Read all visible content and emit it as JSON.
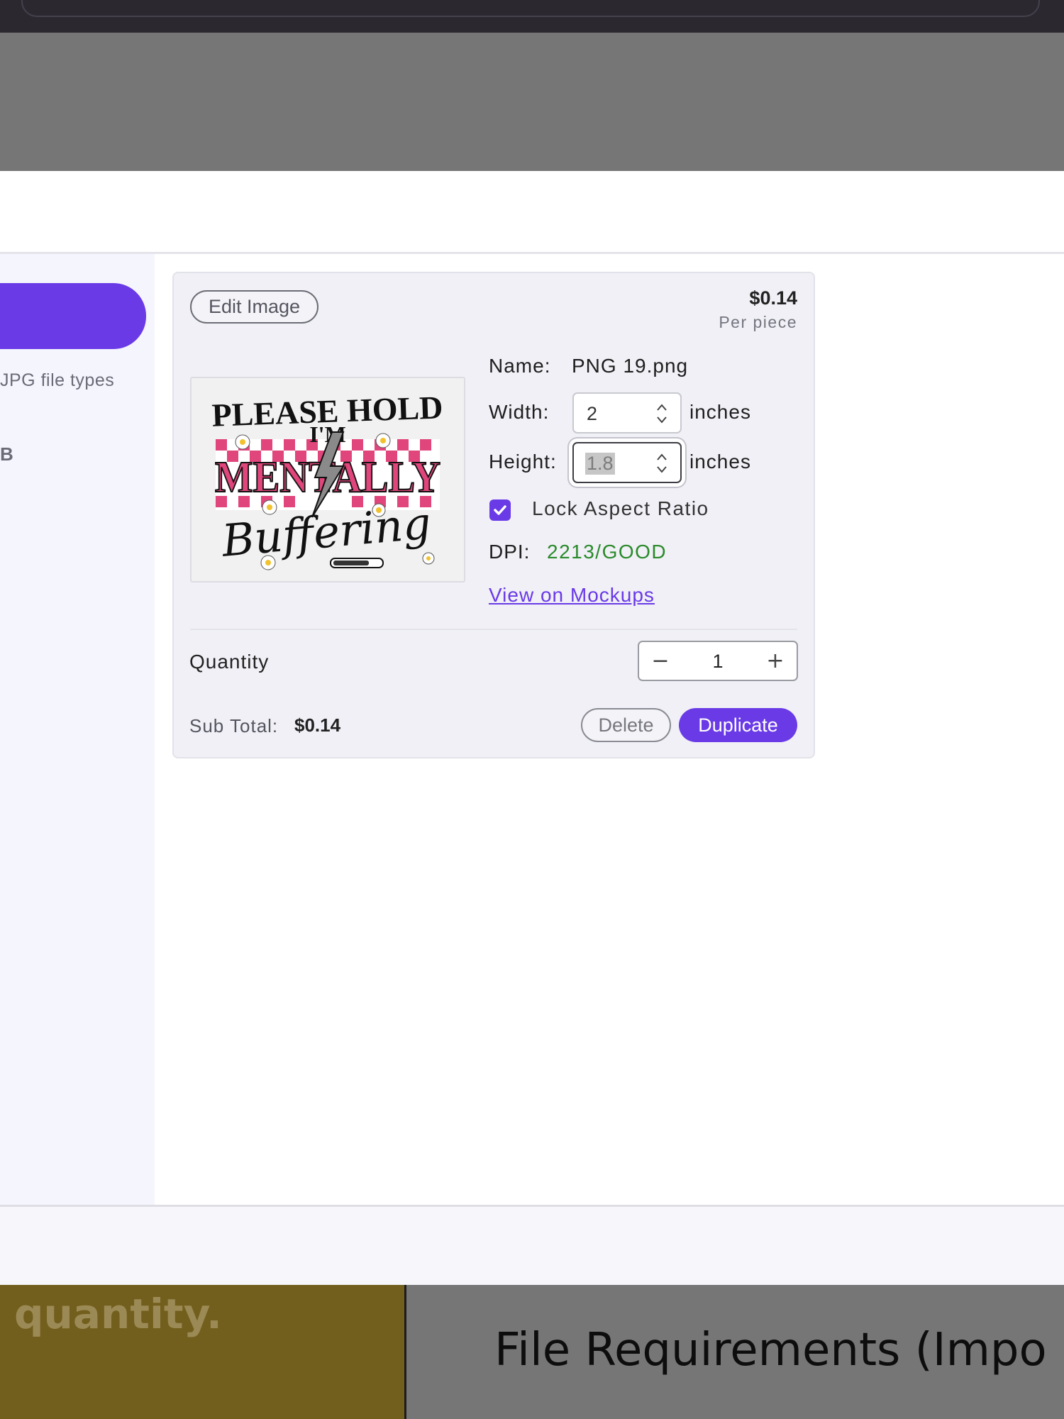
{
  "sidebar": {
    "hint": "JPG file types",
    "char": "B"
  },
  "product": {
    "edit_label": "Edit Image",
    "price": "$0.14",
    "price_unit": "Per piece",
    "name_label": "Name:",
    "name_value": "PNG 19.png",
    "width_label": "Width:",
    "width_value": "2",
    "height_label": "Height:",
    "height_value": "1.8",
    "unit": "inches",
    "lock_label": "Lock Aspect Ratio",
    "lock_checked": true,
    "dpi_label": "DPI:",
    "dpi_value": "2213/GOOD",
    "mockups_link": "View on Mockups",
    "quantity_label": "Quantity",
    "quantity_value": "1",
    "minus": "−",
    "plus": "+",
    "subtotal_label": "Sub Total:",
    "subtotal_value": "$0.14",
    "delete_label": "Delete",
    "duplicate_label": "Duplicate"
  },
  "thumbnail": {
    "line1": "PLEASE HOLD",
    "line2": "I'M",
    "line3": "MENTALLY",
    "line4": "Buffering"
  },
  "footer": {
    "left_text": "quantity.",
    "right_text": "File Requirements (Impo"
  },
  "colors": {
    "accent": "#6a3ae7",
    "good": "#2a8a2a",
    "pink": "#e0457b"
  }
}
